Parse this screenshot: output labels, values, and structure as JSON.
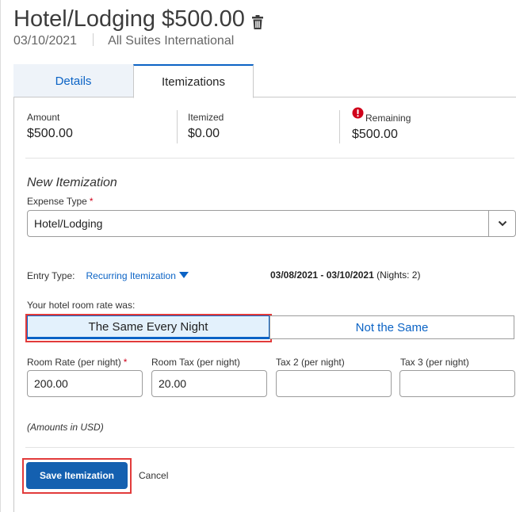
{
  "header": {
    "title": "Hotel/Lodging $500.00",
    "trash_icon": "trash-icon",
    "date": "03/10/2021",
    "vendor": "All Suites International"
  },
  "tabs": [
    {
      "label": "Details",
      "active": false
    },
    {
      "label": "Itemizations",
      "active": true
    }
  ],
  "summary": {
    "amount_label": "Amount",
    "amount_value": "$500.00",
    "itemized_label": "Itemized",
    "itemized_value": "$0.00",
    "remaining_label": "Remaining",
    "remaining_value": "$500.00",
    "remaining_icon": "alert-circle-icon",
    "alert_color": "#d0021b"
  },
  "form": {
    "section_title": "New Itemization",
    "expense_type_label": "Expense Type",
    "required_marker": "*",
    "expense_type_value": "Hotel/Lodging",
    "entry_type_label": "Entry Type:",
    "entry_type_value": "Recurring Itemization",
    "date_range": "03/08/2021 - 03/10/2021",
    "nights": "(Nights: 2)",
    "rate_question": "Your hotel room rate was:",
    "option_same": "The Same Every Night",
    "option_not_same": "Not the Same",
    "room_rate_label": "Room Rate (per night)",
    "room_rate_value": "200.00",
    "room_tax_label": "Room Tax (per night)",
    "room_tax_value": "20.00",
    "tax2_label": "Tax 2 (per night)",
    "tax2_value": "",
    "tax3_label": "Tax 3 (per night)",
    "tax3_value": "",
    "amounts_note": "(Amounts in USD)",
    "save_label": "Save Itemization",
    "cancel_label": "Cancel"
  },
  "colors": {
    "accent": "#0b63c5",
    "primary_button": "#1460b0",
    "highlight_outline": "#e23b3b",
    "selected_segment_bg": "#e3f1fc"
  }
}
